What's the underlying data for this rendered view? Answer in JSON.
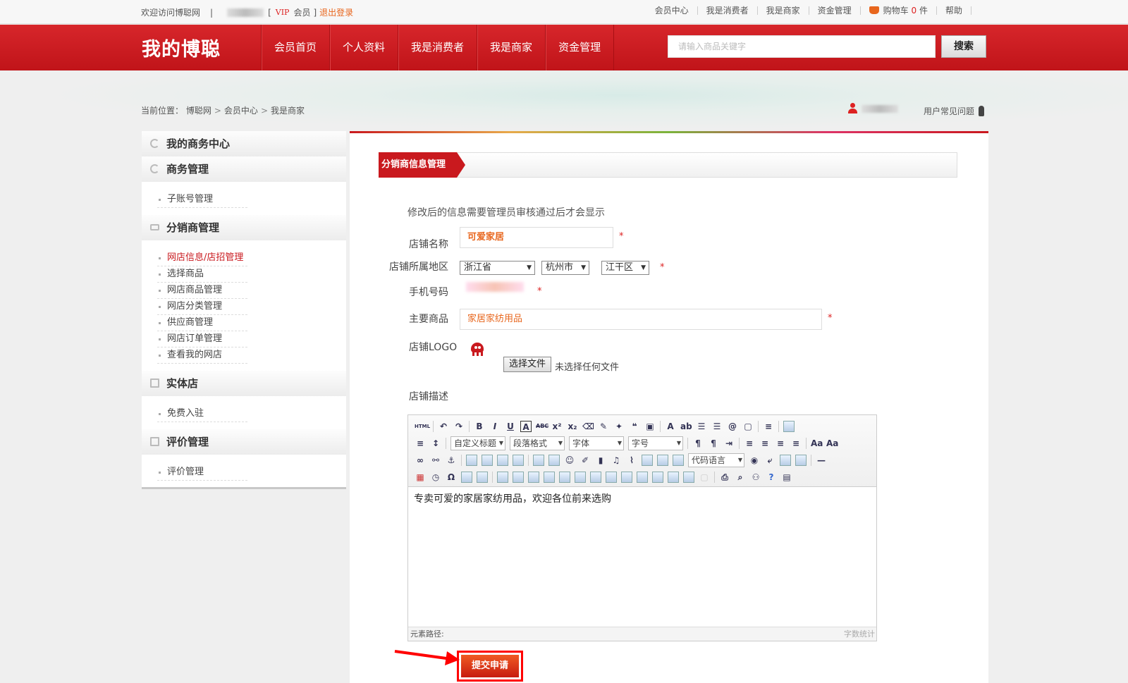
{
  "topbar": {
    "welcome": "欢迎访问博聪网",
    "pipe": "|",
    "bracket_open": "[",
    "vip": "VIP",
    "member": "会员",
    "bracket_close": "]",
    "logout": "退出登录",
    "links": [
      "会员中心",
      "我是消费者",
      "我是商家",
      "资金管理"
    ],
    "cart_label": "购物车",
    "cart_count": "0",
    "cart_unit": "件",
    "help": "帮助"
  },
  "nav": {
    "logo": "我的博聪",
    "menu": [
      "会员首页",
      "个人资料",
      "我是消费者",
      "我是商家",
      "资金管理"
    ],
    "search_placeholder": "请输入商品关键字",
    "search_button": "搜索"
  },
  "breadcrumb": {
    "prefix": "当前位置：",
    "items": [
      "博聪网",
      "会员中心",
      "我是商家"
    ],
    "sep": ">"
  },
  "faq": "用户常见问题",
  "sidebar": {
    "sections": [
      {
        "title": "我的商务中心",
        "items": []
      },
      {
        "title": "商务管理",
        "items": [
          "子账号管理"
        ]
      },
      {
        "title": "分销商管理",
        "items": [
          "网店信息/店招管理",
          "选择商品",
          "网店商品管理",
          "网店分类管理",
          "供应商管理",
          "网店订单管理",
          "查看我的网店"
        ]
      },
      {
        "title": "实体店",
        "items": [
          "免费入驻"
        ]
      },
      {
        "title": "评价管理",
        "items": [
          "评价管理"
        ]
      }
    ]
  },
  "main": {
    "section_title": "分销商信息管理",
    "notice": "修改后的信息需要管理员审核通过后才会显示",
    "form": {
      "shop_name_label": "店铺名称",
      "shop_name_value": "可爱家居",
      "region_label": "店铺所属地区",
      "province": "浙江省",
      "city": "杭州市",
      "district": "江干区",
      "phone_label": "手机号码",
      "goods_label": "主要商品",
      "goods_value": "家居家纺用品",
      "logo_label": "店铺LOGO",
      "file_button": "选择文件",
      "file_status": "未选择任何文件",
      "desc_label": "店铺描述",
      "required_mark": "*"
    },
    "editor": {
      "html_label": "HTML",
      "custom_heading": "自定义标题",
      "paragraph_format": "段落格式",
      "font_family": "字体",
      "font_size": "字号",
      "code_lang": "代码语言",
      "content": "专卖可爱的家居家纺用品，欢迎各位前来选购",
      "path_label": "元素路径:",
      "word_count": "字数统计"
    },
    "submit": "提交申请"
  },
  "colors": {
    "brand_red": "#c9191e",
    "accent_orange": "#e8661d",
    "highlight_red": "#ff0000"
  }
}
